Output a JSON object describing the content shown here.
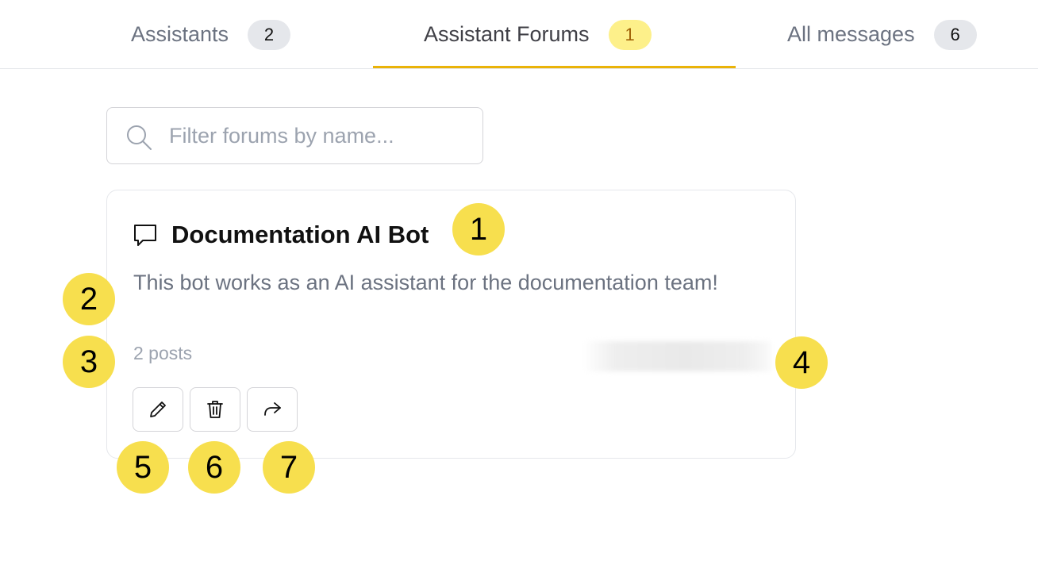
{
  "tabs": [
    {
      "label": "Assistants",
      "count": "2",
      "active": false
    },
    {
      "label": "Assistant Forums",
      "count": "1",
      "active": true
    },
    {
      "label": "All messages",
      "count": "6",
      "active": false
    }
  ],
  "search": {
    "placeholder": "Filter forums by name...",
    "value": "",
    "icon": "search-icon"
  },
  "forum_card": {
    "icon": "chat-bubble-icon",
    "title": "Documentation AI Bot",
    "description": "This bot works as an AI assistant for the documentation team!",
    "posts": "2 posts",
    "actions": [
      {
        "name": "edit",
        "icon": "pencil-icon"
      },
      {
        "name": "delete",
        "icon": "trash-icon"
      },
      {
        "name": "share",
        "icon": "share-arrow-icon"
      }
    ]
  },
  "markers": [
    "1",
    "2",
    "3",
    "4",
    "5",
    "6",
    "7"
  ],
  "colors": {
    "accent": "#eab308",
    "active_badge_bg": "#fdf08a",
    "active_badge_text": "#a16207",
    "badge_bg": "#e5e7eb",
    "marker_bg": "#f7df4e"
  }
}
